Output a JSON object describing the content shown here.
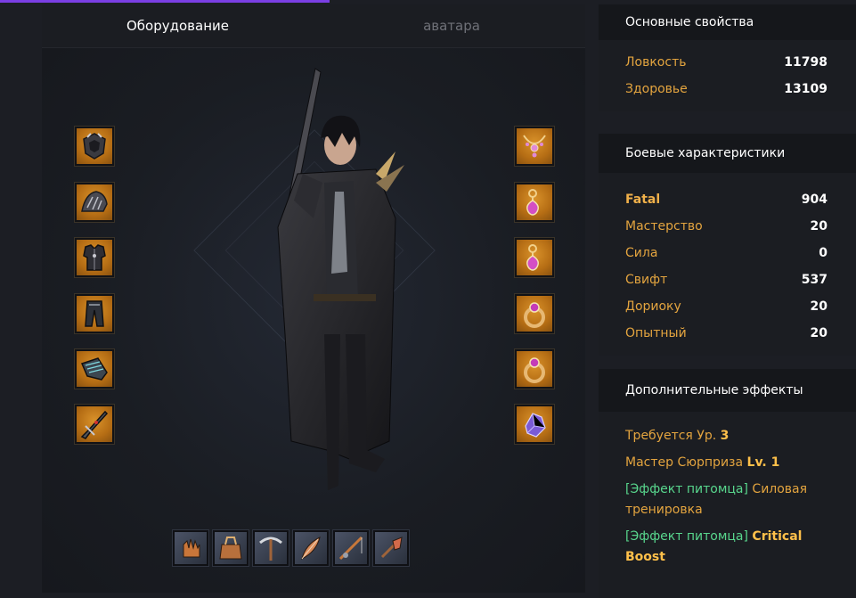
{
  "tabs": {
    "equipment": "Оборудование",
    "avatar": "аватара"
  },
  "equipment_left": [
    "helmet-icon",
    "shoulder-armor-icon",
    "chest-armor-icon",
    "pants-icon",
    "gloves-icon",
    "weapon-icon"
  ],
  "equipment_right": [
    "necklace-icon",
    "earring-icon",
    "earring-icon",
    "ring-icon",
    "ring-icon",
    "crystal-icon"
  ],
  "bottom_slots": [
    "gathering-glove-icon",
    "bag-icon",
    "pickaxe-icon",
    "feather-icon",
    "fishing-rod-icon",
    "shovel-icon"
  ],
  "basic": {
    "title": "Основные свойства",
    "stats": [
      {
        "label": "Ловкость",
        "value": "11798"
      },
      {
        "label": "Здоровье",
        "value": "13109"
      }
    ]
  },
  "combat": {
    "title": "Боевые характеристики",
    "stats": [
      {
        "label": "Fatal",
        "value": "904"
      },
      {
        "label": "Мастерство",
        "value": "20"
      },
      {
        "label": "Сила",
        "value": "0"
      },
      {
        "label": "Свифт",
        "value": "537"
      },
      {
        "label": "Дориоку",
        "value": "20"
      },
      {
        "label": "Опытный",
        "value": "20"
      }
    ]
  },
  "effects": {
    "title": "Дополнительные эффекты",
    "e1_text": "Требуется Ур.",
    "e1_value": "3",
    "e2_text": "Мастер Сюрприза",
    "e2_value": "Lv. 1",
    "e3_pet": "[Эффект питомца]",
    "e3_text": "Силовая тренировка",
    "e4_pet": "[Эффект питомца]",
    "e4_text": "Critical Boost"
  },
  "colors": {
    "accent": "#7b3fe4",
    "stat_label": "#e3a43f",
    "pet_effect": "#58d68d"
  }
}
